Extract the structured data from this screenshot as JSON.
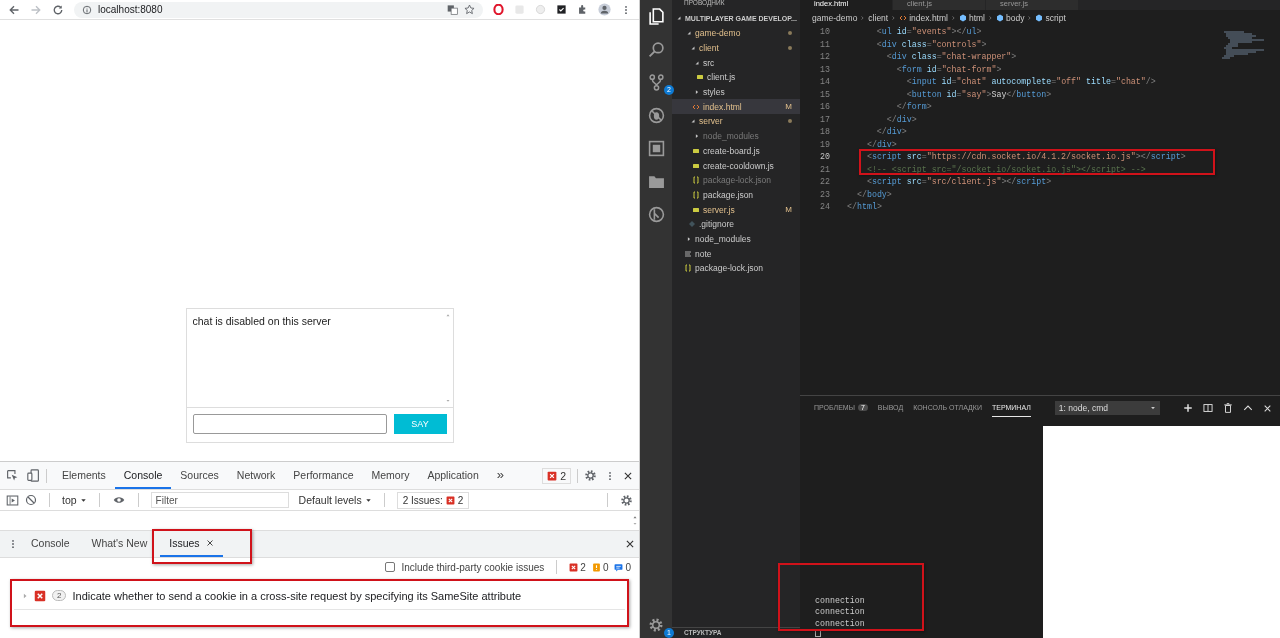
{
  "browser": {
    "address": "localhost:8080",
    "chat": {
      "messages": [
        "chat is disabled on this server"
      ],
      "button": "SAY"
    },
    "devtools": {
      "tabs": [
        {
          "label": "Elements",
          "selected": false
        },
        {
          "label": "Console",
          "selected": true
        },
        {
          "label": "Sources",
          "selected": false
        },
        {
          "label": "Network",
          "selected": false
        },
        {
          "label": "Performance",
          "selected": false
        },
        {
          "label": "Memory",
          "selected": false
        },
        {
          "label": "Application",
          "selected": false
        }
      ],
      "more": "»",
      "error_count": "2",
      "console_toolbar": {
        "context": "top",
        "filter_placeholder": "Filter",
        "levels": "Default levels",
        "issues_label": "2 Issues:",
        "issues_count": "2"
      },
      "drawer": {
        "tabs": [
          {
            "label": "Console",
            "selected": false,
            "closable": false,
            "highlighted": false
          },
          {
            "label": "What's New",
            "selected": false,
            "closable": false,
            "highlighted": false
          },
          {
            "label": "Issues",
            "selected": true,
            "closable": true,
            "highlighted": true
          }
        ],
        "third_party": {
          "label": "Include third-party cookie issues",
          "checked": false
        },
        "counts": [
          {
            "kind": "error",
            "text": "2"
          },
          {
            "kind": "warning",
            "text": "0"
          },
          {
            "kind": "info",
            "text": "0"
          }
        ],
        "issues": [
          {
            "count": "2",
            "text": "Indicate whether to send a cookie in a cross-site request by specifying its SameSite attribute",
            "expanded": false,
            "highlighted": true
          }
        ]
      }
    }
  },
  "vscode": {
    "activity": [
      {
        "kind": "files",
        "selected": true
      },
      {
        "kind": "search",
        "selected": false
      },
      {
        "kind": "source-control",
        "selected": false,
        "badge": "2"
      },
      {
        "kind": "no-debug",
        "selected": false
      },
      {
        "kind": "extensions",
        "selected": false
      },
      {
        "kind": "folder",
        "selected": false
      },
      {
        "kind": "circled",
        "selected": false
      }
    ],
    "settings_badge": "1",
    "explorer": {
      "title": "ПРОВОДНИК",
      "project": "MULTIPLAYER GAME DEVELOP...",
      "footer": "СТРУКТУРА",
      "tree": [
        {
          "name": "game-demo",
          "kind": "folder",
          "expanded": true,
          "selected": false,
          "modified": true,
          "modified_dot": true,
          "children": [
            {
              "name": "client",
              "kind": "folder",
              "expanded": true,
              "selected": false,
              "modified": true,
              "modified_dot": true,
              "children": [
                {
                  "name": "src",
                  "kind": "folder",
                  "expanded": true,
                  "selected": false,
                  "children": [
                    {
                      "name": "client.js",
                      "kind": "js",
                      "selected": false
                    }
                  ]
                },
                {
                  "name": "styles",
                  "kind": "folder",
                  "expanded": false,
                  "selected": false
                },
                {
                  "name": "index.html",
                  "kind": "html",
                  "selected": true,
                  "modified": true,
                  "badge": "M"
                }
              ]
            },
            {
              "name": "server",
              "kind": "folder",
              "expanded": true,
              "selected": false,
              "modified": true,
              "modified_dot": true,
              "children": [
                {
                  "name": "node_modules",
                  "kind": "folder",
                  "expanded": false,
                  "selected": false,
                  "ignored": true
                },
                {
                  "name": "create-board.js",
                  "kind": "js",
                  "selected": false
                },
                {
                  "name": "create-cooldown.js",
                  "kind": "js",
                  "selected": false
                },
                {
                  "name": "package-lock.json",
                  "kind": "json",
                  "selected": false,
                  "ignored": true
                },
                {
                  "name": "package.json",
                  "kind": "json",
                  "selected": false
                },
                {
                  "name": "server.js",
                  "kind": "js",
                  "selected": false,
                  "modified": true,
                  "badge": "M"
                }
              ]
            },
            {
              "name": ".gitignore",
              "kind": "git",
              "selected": false
            }
          ]
        },
        {
          "name": "node_modules",
          "kind": "folder",
          "expanded": false,
          "selected": false
        },
        {
          "name": "note",
          "kind": "text",
          "selected": false
        },
        {
          "name": "package-lock.json",
          "kind": "json",
          "selected": false
        }
      ]
    },
    "editor": {
      "tabs": [
        {
          "label": "index.html",
          "selected": true
        },
        {
          "label": "client.js",
          "selected": false
        },
        {
          "label": "server.js",
          "selected": false
        }
      ],
      "breadcrumb": [
        {
          "text": "game-demo",
          "kind": "folder"
        },
        {
          "text": "client",
          "kind": "folder"
        },
        {
          "text": "index.html",
          "kind": "html"
        },
        {
          "text": "html",
          "kind": "element"
        },
        {
          "text": "body",
          "kind": "element"
        },
        {
          "text": "script",
          "kind": "element"
        }
      ],
      "lines": [
        {
          "number": "10",
          "current": false,
          "tokens": [
            {
              "kind": "punct",
              "text": "      <"
            },
            {
              "kind": "tag",
              "text": "ul"
            },
            {
              "kind": "attr",
              "text": " id"
            },
            {
              "kind": "punct",
              "text": "="
            },
            {
              "kind": "str",
              "text": "\"events\""
            },
            {
              "kind": "punct",
              "text": "></"
            },
            {
              "kind": "tag",
              "text": "ul"
            },
            {
              "kind": "punct",
              "text": ">"
            }
          ]
        },
        {
          "number": "11",
          "current": false,
          "tokens": [
            {
              "kind": "punct",
              "text": "      <"
            },
            {
              "kind": "tag",
              "text": "div"
            },
            {
              "kind": "attr",
              "text": " class"
            },
            {
              "kind": "punct",
              "text": "="
            },
            {
              "kind": "str",
              "text": "\"controls\""
            },
            {
              "kind": "punct",
              "text": ">"
            }
          ]
        },
        {
          "number": "12",
          "current": false,
          "tokens": [
            {
              "kind": "punct",
              "text": "        <"
            },
            {
              "kind": "tag",
              "text": "div"
            },
            {
              "kind": "attr",
              "text": " class"
            },
            {
              "kind": "punct",
              "text": "="
            },
            {
              "kind": "str",
              "text": "\"chat-wrapper\""
            },
            {
              "kind": "punct",
              "text": ">"
            }
          ]
        },
        {
          "number": "13",
          "current": false,
          "tokens": [
            {
              "kind": "punct",
              "text": "          <"
            },
            {
              "kind": "tag",
              "text": "form"
            },
            {
              "kind": "attr",
              "text": " id"
            },
            {
              "kind": "punct",
              "text": "="
            },
            {
              "kind": "str",
              "text": "\"chat-form\""
            },
            {
              "kind": "punct",
              "text": ">"
            }
          ]
        },
        {
          "number": "14",
          "current": false,
          "tokens": [
            {
              "kind": "punct",
              "text": "            <"
            },
            {
              "kind": "tag",
              "text": "input"
            },
            {
              "kind": "attr",
              "text": " id"
            },
            {
              "kind": "punct",
              "text": "="
            },
            {
              "kind": "str",
              "text": "\"chat\""
            },
            {
              "kind": "attr",
              "text": " autocomplete"
            },
            {
              "kind": "punct",
              "text": "="
            },
            {
              "kind": "str",
              "text": "\"off\""
            },
            {
              "kind": "attr",
              "text": " title"
            },
            {
              "kind": "punct",
              "text": "="
            },
            {
              "kind": "str",
              "text": "\"chat\""
            },
            {
              "kind": "punct",
              "text": "/>"
            }
          ]
        },
        {
          "number": "15",
          "current": false,
          "tokens": [
            {
              "kind": "punct",
              "text": "            <"
            },
            {
              "kind": "tag",
              "text": "button"
            },
            {
              "kind": "attr",
              "text": " id"
            },
            {
              "kind": "punct",
              "text": "="
            },
            {
              "kind": "str",
              "text": "\"say\""
            },
            {
              "kind": "punct",
              "text": ">"
            },
            {
              "kind": "text",
              "text": "Say"
            },
            {
              "kind": "punct",
              "text": "</"
            },
            {
              "kind": "tag",
              "text": "button"
            },
            {
              "kind": "punct",
              "text": ">"
            }
          ]
        },
        {
          "number": "16",
          "current": false,
          "tokens": [
            {
              "kind": "punct",
              "text": "          </"
            },
            {
              "kind": "tag",
              "text": "form"
            },
            {
              "kind": "punct",
              "text": ">"
            }
          ]
        },
        {
          "number": "17",
          "current": false,
          "tokens": [
            {
              "kind": "punct",
              "text": "        </"
            },
            {
              "kind": "tag",
              "text": "div"
            },
            {
              "kind": "punct",
              "text": ">"
            }
          ]
        },
        {
          "number": "18",
          "current": false,
          "tokens": [
            {
              "kind": "punct",
              "text": "      </"
            },
            {
              "kind": "tag",
              "text": "div"
            },
            {
              "kind": "punct",
              "text": ">"
            }
          ]
        },
        {
          "number": "19",
          "current": false,
          "tokens": [
            {
              "kind": "punct",
              "text": "    </"
            },
            {
              "kind": "tag",
              "text": "div"
            },
            {
              "kind": "punct",
              "text": ">"
            }
          ]
        },
        {
          "number": "20",
          "current": true,
          "highlighted": true,
          "tokens": [
            {
              "kind": "punct",
              "text": "    <"
            },
            {
              "kind": "tag",
              "text": "script"
            },
            {
              "kind": "attr",
              "text": " src"
            },
            {
              "kind": "punct",
              "text": "="
            },
            {
              "kind": "str",
              "text": "\"https://cdn.socket.io/4.1.2/socket.io.js\""
            },
            {
              "kind": "punct",
              "text": "></"
            },
            {
              "kind": "tag",
              "text": "script"
            },
            {
              "kind": "punct",
              "text": ">"
            }
          ]
        },
        {
          "number": "21",
          "current": false,
          "tokens": [
            {
              "kind": "comment",
              "text": "    <!-- <script src=\"/socket.io/socket.io.js\"></script> -->"
            }
          ]
        },
        {
          "number": "22",
          "current": false,
          "tokens": [
            {
              "kind": "punct",
              "text": "    <"
            },
            {
              "kind": "tag",
              "text": "script"
            },
            {
              "kind": "attr",
              "text": " src"
            },
            {
              "kind": "punct",
              "text": "="
            },
            {
              "kind": "str",
              "text": "\"src/client.js\""
            },
            {
              "kind": "punct",
              "text": "></"
            },
            {
              "kind": "tag",
              "text": "script"
            },
            {
              "kind": "punct",
              "text": ">"
            }
          ]
        },
        {
          "number": "23",
          "current": false,
          "tokens": [
            {
              "kind": "punct",
              "text": "  </"
            },
            {
              "kind": "tag",
              "text": "body"
            },
            {
              "kind": "punct",
              "text": ">"
            }
          ]
        },
        {
          "number": "24",
          "current": false,
          "tokens": [
            {
              "kind": "punct",
              "text": "</"
            },
            {
              "kind": "tag",
              "text": "html"
            },
            {
              "kind": "punct",
              "text": ">"
            }
          ]
        }
      ]
    },
    "panel": {
      "tabs": [
        {
          "label": "ПРОБЛЕМЫ",
          "badge": "7",
          "selected": false
        },
        {
          "label": "ВЫВОД",
          "selected": false
        },
        {
          "label": "КОНСОЛЬ ОТЛАДКИ",
          "selected": false
        },
        {
          "label": "ТЕРМИНАЛ",
          "selected": true
        }
      ],
      "terminal_select": "1: node, cmd",
      "terminal": {
        "lines": [
          "connection",
          "connection",
          "connection"
        ],
        "highlighted": true
      }
    }
  }
}
